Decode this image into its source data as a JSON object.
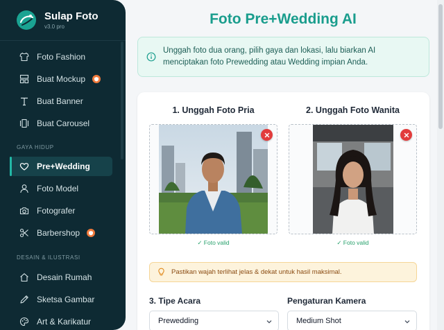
{
  "brand": {
    "title": "Sulap Foto",
    "version": "v3.0 pro"
  },
  "sidebar": {
    "items_top": [
      {
        "label": "Foto Fashion",
        "icon": "shirt-icon"
      },
      {
        "label": "Buat Mockup",
        "icon": "layout-icon",
        "badge": true
      },
      {
        "label": "Buat Banner",
        "icon": "text-icon"
      },
      {
        "label": "Buat Carousel",
        "icon": "carousel-icon"
      }
    ],
    "section_lifestyle": "GAYA HIDUP",
    "items_lifestyle": [
      {
        "label": "Pre+Wedding",
        "icon": "heart-icon",
        "active": true
      },
      {
        "label": "Foto Model",
        "icon": "user-icon"
      },
      {
        "label": "Fotografer",
        "icon": "camera-icon"
      },
      {
        "label": "Barbershop",
        "icon": "scissors-icon",
        "badge": true
      }
    ],
    "section_design": "DESAIN & ILUSTRASI",
    "items_design": [
      {
        "label": "Desain Rumah",
        "icon": "home-icon"
      },
      {
        "label": "Sketsa Gambar",
        "icon": "pencil-icon"
      },
      {
        "label": "Art & Karikatur",
        "icon": "palette-icon"
      }
    ],
    "colors": {
      "background": "#0e2a33",
      "accent": "#22b8a6",
      "badge": "#f07a3c"
    }
  },
  "main": {
    "title": "Foto Pre+Wedding AI",
    "info": "Unggah foto dua orang, pilih gaya dan lokasi, lalu biarkan AI menciptakan foto Prewedding atau Wedding impian Anda.",
    "upload_male": {
      "title": "1. Unggah Foto Pria",
      "status": "✓ Foto valid"
    },
    "upload_female": {
      "title": "2. Unggah Foto Wanita",
      "status": "✓ Foto valid"
    },
    "tip": "Pastikan wajah terlihat jelas & dekat untuk hasil maksimal.",
    "event_type": {
      "label": "3. Tipe Acara",
      "value": "Prewedding"
    },
    "camera": {
      "label": "Pengaturan Kamera",
      "value": "Medium Shot"
    },
    "colors": {
      "title": "#1a9d8d",
      "remove": "#e23c3c",
      "valid": "#25a06a"
    }
  }
}
